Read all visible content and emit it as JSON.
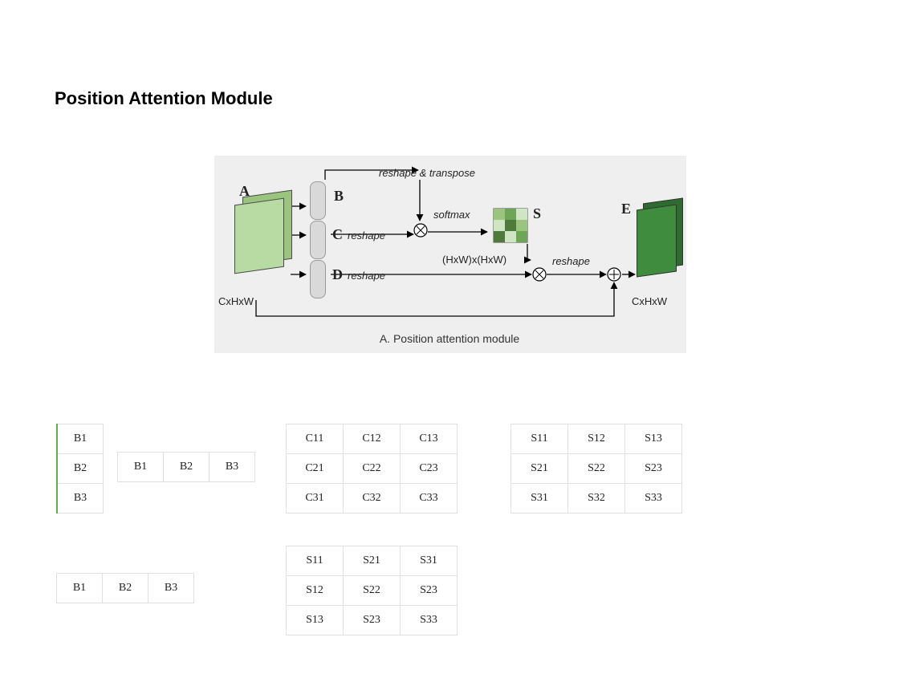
{
  "title": "Position Attention Module",
  "caption": "A. Position attention module",
  "labels": {
    "A": "A",
    "B": "B",
    "C": "C",
    "D": "D",
    "E": "E",
    "S": "S",
    "reshape_transpose": "reshape & transpose",
    "reshape": "reshape",
    "softmax": "softmax",
    "dim_A": "CxHxW",
    "dim_E": "CxHxW",
    "dim_S": "(HxW)x(HxW)"
  },
  "vec_B_col": [
    "B1",
    "B2",
    "B3"
  ],
  "vec_B_row": [
    "B1",
    "B2",
    "B3"
  ],
  "vec_B_row2": [
    "B1",
    "B2",
    "B3"
  ],
  "mat_C": [
    [
      "C11",
      "C12",
      "C13"
    ],
    [
      "C21",
      "C22",
      "C23"
    ],
    [
      "C31",
      "C32",
      "C33"
    ]
  ],
  "mat_S": [
    [
      "S11",
      "S12",
      "S13"
    ],
    [
      "S21",
      "S22",
      "S23"
    ],
    [
      "S31",
      "S32",
      "S33"
    ]
  ],
  "mat_ST": [
    [
      "S11",
      "S21",
      "S31"
    ],
    [
      "S12",
      "S22",
      "S23"
    ],
    [
      "S13",
      "S23",
      "S33"
    ]
  ]
}
